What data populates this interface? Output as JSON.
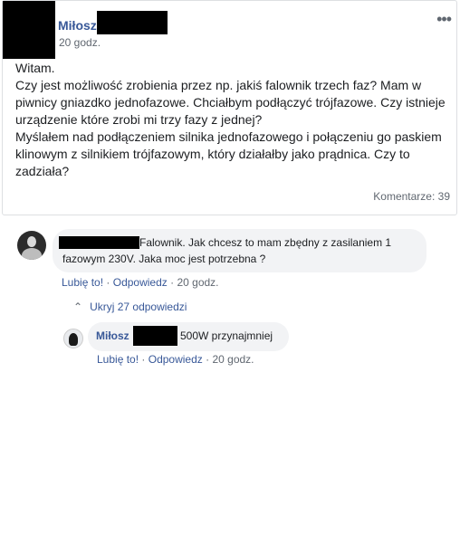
{
  "post": {
    "author": "Miłosz",
    "time": "20 godz.",
    "more_label": "•••",
    "paragraphs": [
      "Witam.",
      "Czy jest możliwość zrobienia przez np. jakiś falownik trzech faz? Mam w piwnicy gniazdko jednofazowe. Chciałbym podłączyć trójfazowe. Czy istnieje urządzenie które zrobi mi trzy fazy z jednej?",
      "Myślałem nad podłączeniem silnika jednofazowego i połączeniu go paskiem klinowym z silnikiem trójfazowym, który działałby jako prądnica. Czy to zadziała?"
    ],
    "comments_count": "Komentarze: 39"
  },
  "comment": {
    "text": "Falownik. Jak chcesz to mam zbędny z zasilaniem 1 fazowym 230V. Jaka moc jest potrzebna ?",
    "like": "Lubię to!",
    "reply": "Odpowiedz",
    "sep": "·",
    "time": "20 godz."
  },
  "replies_toggle": {
    "chevron": "⌃",
    "label": "Ukryj 27 odpowiedzi"
  },
  "reply": {
    "author": "Miłosz",
    "text": "500W przynajmniej",
    "like": "Lubię to!",
    "reply": "Odpowiedz",
    "sep": "·",
    "time": "20 godz."
  },
  "colors": {
    "link": "#385898",
    "meta": "#606770",
    "bubble": "#f2f3f5"
  }
}
